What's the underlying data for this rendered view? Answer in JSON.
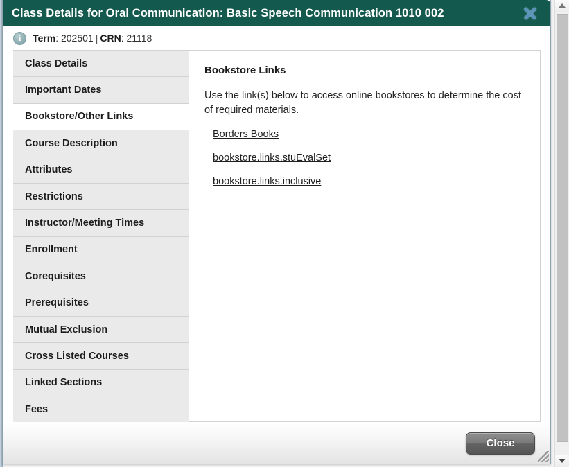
{
  "dialog": {
    "title": "Class Details for Oral Communication: Basic Speech Communication 1010 002",
    "close_icon_label": "close-icon",
    "accent_color": "#14594d",
    "close_icon_color": "#5c93b8"
  },
  "info": {
    "term_label": "Term",
    "term_value": "202501",
    "separator": "|",
    "crn_label": "CRN",
    "crn_value": "21118"
  },
  "sidebar": {
    "items": [
      {
        "label": "Class Details",
        "active": false
      },
      {
        "label": "Important Dates",
        "active": false
      },
      {
        "label": "Bookstore/Other Links",
        "active": true
      },
      {
        "label": "Course Description",
        "active": false
      },
      {
        "label": "Attributes",
        "active": false
      },
      {
        "label": "Restrictions",
        "active": false
      },
      {
        "label": "Instructor/Meeting Times",
        "active": false
      },
      {
        "label": "Enrollment",
        "active": false
      },
      {
        "label": "Corequisites",
        "active": false
      },
      {
        "label": "Prerequisites",
        "active": false
      },
      {
        "label": "Mutual Exclusion",
        "active": false
      },
      {
        "label": "Cross Listed Courses",
        "active": false
      },
      {
        "label": "Linked Sections",
        "active": false
      },
      {
        "label": "Fees",
        "active": false
      }
    ]
  },
  "content": {
    "heading": "Bookstore Links",
    "intro": "Use the link(s) below to access online bookstores to determine the cost of required materials.",
    "links": [
      {
        "label": "Borders Books"
      },
      {
        "label": "bookstore.links.stuEvalSet"
      },
      {
        "label": "bookstore.links.inclusive"
      }
    ]
  },
  "footer": {
    "close_button_label": "Close",
    "resize_grip_label": "resize-grip"
  },
  "scrollbar": {
    "up_arrow_label": "scroll-up-arrow",
    "down_arrow_label": "scroll-down-arrow"
  }
}
